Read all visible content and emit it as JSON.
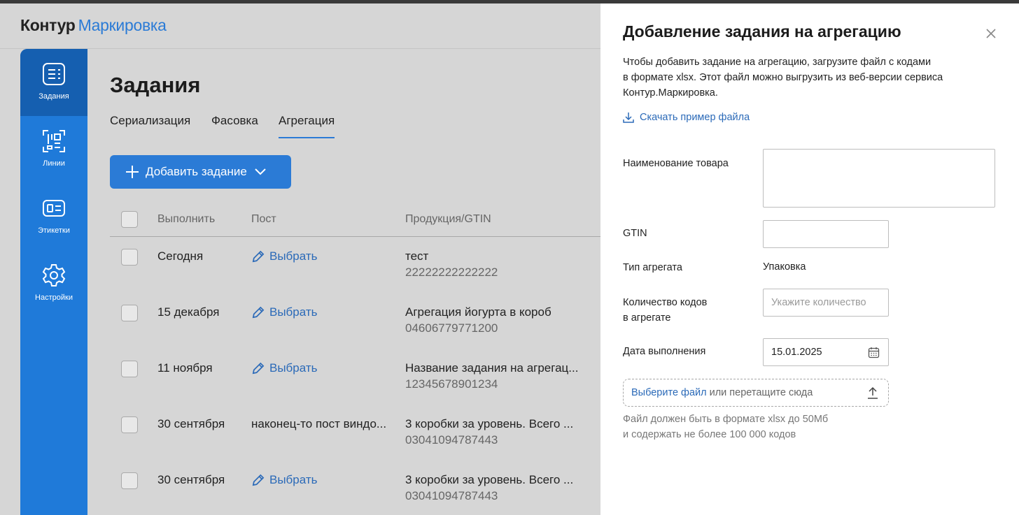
{
  "header": {
    "logo_part1": "Контур",
    "logo_part2": "Маркировка"
  },
  "sidebar": {
    "items": [
      {
        "label": "Задания",
        "icon": "tasks-icon",
        "active": true
      },
      {
        "label": "Линии",
        "icon": "lines-icon"
      },
      {
        "label": "Этикетки",
        "icon": "labels-icon"
      },
      {
        "label": "Настройки",
        "icon": "gear-icon"
      }
    ]
  },
  "main": {
    "title": "Задания",
    "tabs": [
      {
        "label": "Сериализация"
      },
      {
        "label": "Фасовка"
      },
      {
        "label": "Агрегация",
        "active": true
      }
    ],
    "add_button": "Добавить задание",
    "columns": {
      "execute": "Выполнить",
      "post": "Пост",
      "product": "Продукция/GTIN"
    },
    "rows": [
      {
        "date": "Сегодня",
        "post": "Выбрать",
        "product": "тест",
        "gtin": "22222222222222"
      },
      {
        "date": "15 декабря",
        "post": "Выбрать",
        "product": "Агрегация йогурта в короб",
        "gtin": "04606779771200"
      },
      {
        "date": "11 ноября",
        "post": "Выбрать",
        "product": "Название задания на агрегац...",
        "gtin": "12345678901234"
      },
      {
        "date": "30 сентября",
        "post": "наконец-то пост виндо...",
        "product": "3 коробки за уровень. Всего ...",
        "gtin": "03041094787443"
      },
      {
        "date": "30 сентября",
        "post": "Выбрать",
        "product": "3 коробки за уровень. Всего ...",
        "gtin": "03041094787443"
      }
    ]
  },
  "panel": {
    "title": "Добавление задания на агрегацию",
    "desc_line1": "Чтобы добавить задание на агрегацию, загрузите файл с кодами",
    "desc_line2": "в формате xlsx. Этот файл можно выгрузить из веб-версии сервиса",
    "desc_line3": "Контур.Маркировка.",
    "download_link": "Скачать пример файла",
    "product_name_label": "Наименование товара",
    "gtin_label": "GTIN",
    "aggregate_type_label": "Тип агрегата",
    "aggregate_type_value": "Упаковка",
    "codes_count_label_1": "Количество кодов",
    "codes_count_label_2": "в агрегате",
    "codes_count_placeholder": "Укажите количество",
    "date_label": "Дата выполнения",
    "date_value": "15.01.2025",
    "upload_link": "Выберите файл",
    "upload_text": "или перетащите сюда",
    "hint_line1": "Файл должен быть в формате xlsx до 50Мб",
    "hint_line2": "и содержать не более 100 000 кодов"
  }
}
